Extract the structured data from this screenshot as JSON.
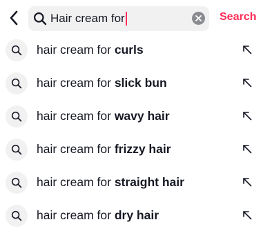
{
  "search": {
    "query": "Hair cream for",
    "button_label": "Search"
  },
  "icons": {
    "back": "chevron-left-icon",
    "search": "search-icon",
    "clear": "clear-icon",
    "fill": "arrow-up-left-icon"
  },
  "colors": {
    "accent": "#fe2c55",
    "field_bg": "#f1f1f2",
    "text": "#161823"
  },
  "suggestions": [
    {
      "prefix": "hair cream for ",
      "highlight": "curls"
    },
    {
      "prefix": "hair cream for ",
      "highlight": "slick bun"
    },
    {
      "prefix": "hair cream for ",
      "highlight": "wavy hair"
    },
    {
      "prefix": "hair cream for ",
      "highlight": "frizzy hair"
    },
    {
      "prefix": "hair cream for ",
      "highlight": "straight hair"
    },
    {
      "prefix": "hair cream for ",
      "highlight": "dry hair"
    }
  ]
}
